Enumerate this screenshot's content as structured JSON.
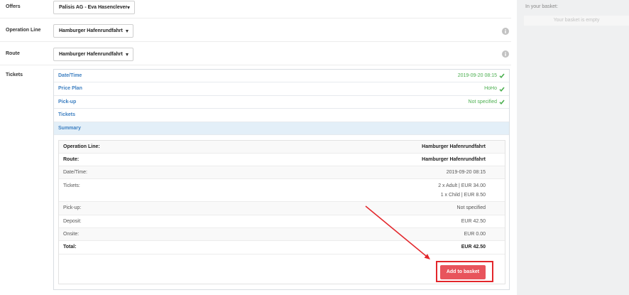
{
  "form": {
    "offers_label": "Offers",
    "offers_value": "Palisis AG - Eva Hasenclever",
    "operation_line_label": "Operation Line",
    "operation_line_value": "Hamburger Hafenrundfahrt",
    "route_label": "Route",
    "route_value": "Hamburger Hafenrundfahrt",
    "tickets_label": "Tickets"
  },
  "steps": [
    {
      "label": "Date/Time",
      "value": "2019-09-20 08:15",
      "checked": true
    },
    {
      "label": "Price Plan",
      "value": "HoHo",
      "checked": true
    },
    {
      "label": "Pick-up",
      "value": "Not specified",
      "checked": true
    },
    {
      "label": "Tickets",
      "checked": false
    },
    {
      "label": "Summary",
      "checked": false
    }
  ],
  "summary": [
    {
      "label": "Operation Line:",
      "value": "Hamburger Hafenrundfahrt"
    },
    {
      "label": "Route:",
      "value": "Hamburger Hafenrundfahrt"
    },
    {
      "label": "Date/Time:",
      "value": "2019-09-20 08:15"
    },
    {
      "label": "Tickets:",
      "values": [
        "2 x Adult | EUR 34.00",
        "1 x Child | EUR 8.50"
      ]
    },
    {
      "label": "Pick-up:",
      "value": "Not specified"
    },
    {
      "label": "Deposit:",
      "value": "EUR 42.50"
    },
    {
      "label": "Onsite:",
      "value": "EUR 0.00"
    },
    {
      "label": "Total:",
      "value": "EUR 42.50"
    }
  ],
  "add_to_basket_label": "Add to basket",
  "basket": {
    "title": "In your basket:",
    "empty_text": "Your basket is empty"
  },
  "icons": {
    "dropdown": "chevron-down-icon",
    "info": "info-icon",
    "step_done": "check-icon",
    "annotation": "arrow-icon"
  },
  "colors": {
    "link_blue": "#3d7fc1",
    "success_green": "#4caf50",
    "button_red": "#e8545c",
    "annotation_red": "#e3262b",
    "active_step_bg": "#e3eff8",
    "basket_bg": "#eff0f1"
  }
}
